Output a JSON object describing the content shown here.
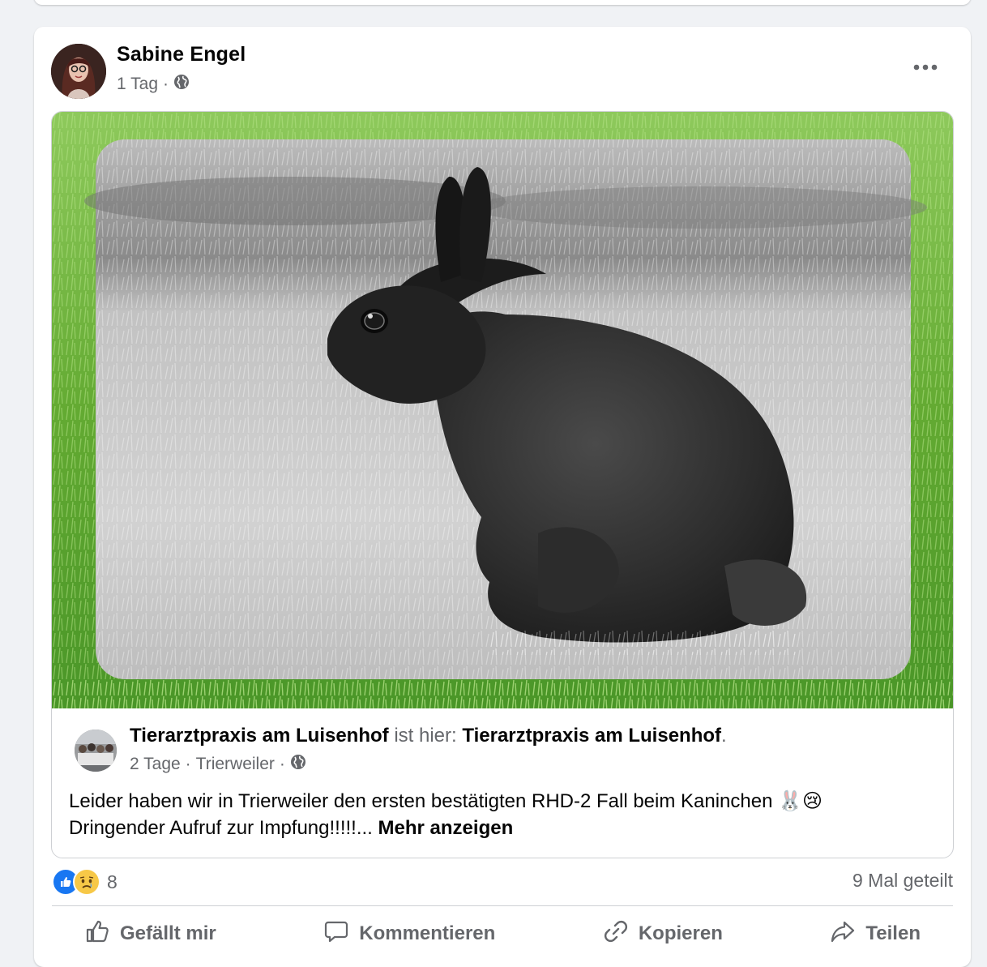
{
  "post": {
    "author": "Sabine Engel",
    "time": "1 Tag",
    "separator": "·",
    "privacy_icon": "globe-icon",
    "more_icon": "more-horizontal-icon"
  },
  "shared_post": {
    "page_name": "Tierarztpraxis am Luisenhof",
    "status_text": "ist hier:",
    "location_name": "Tierarztpraxis am Luisenhof",
    "period": ".",
    "time": "2 Tage",
    "place": "Trierweiler",
    "separator": "·",
    "text_line1": "Leider haben wir in Trierweiler den ersten bestätigten RHD-2 Fall beim Kaninchen 🐰😢",
    "text_line2": "Dringender Aufruf zur Impfung!!!!!...",
    "see_more": "Mehr anzeigen"
  },
  "reactions": {
    "count": "8",
    "types": [
      "like",
      "sad"
    ],
    "like_color": "#1877f2"
  },
  "shares": "9 Mal geteilt",
  "actions": {
    "like": "Gefällt mir",
    "comment": "Kommentieren",
    "copy": "Kopieren",
    "share": "Teilen"
  }
}
